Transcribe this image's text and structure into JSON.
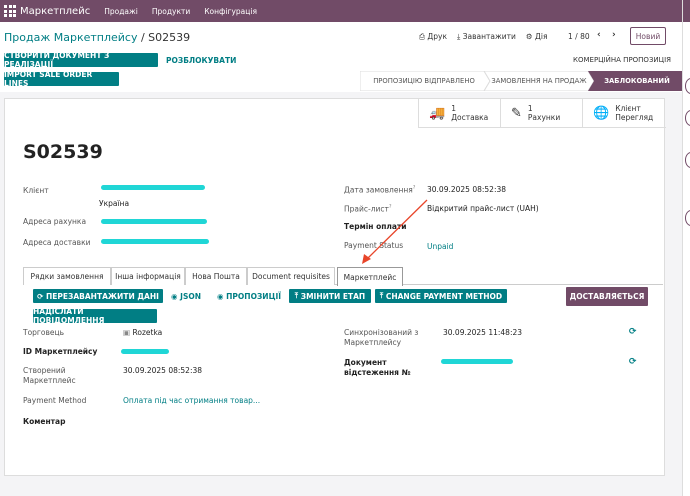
{
  "topbar": {
    "brand": "Маркетплейс",
    "menus": [
      "Продажі",
      "Продукти",
      "Конфігурація"
    ]
  },
  "breadcrumb": {
    "parent": "Продаж Маркетплейсу",
    "separator": " / ",
    "current": "S02539"
  },
  "actions": {
    "print": "Друк",
    "download": "Завантажити",
    "action": "Дія"
  },
  "pager": {
    "value": "1 / 80"
  },
  "new_button": "Новий",
  "header_buttons": {
    "create_doc": "СТВОРИТИ ДОКУМЕНТ З РЕАЛІЗАЦІЇ",
    "unlock": "РОЗБЛОКУВАТИ",
    "import_lines": "IMPORT SALE ORDER LINES",
    "commercial_offer": "КОМЕРЦІЙНА ПРОПОЗИЦІЯ"
  },
  "stages": [
    "ПРОПОЗИЦІЮ ВІДПРАВЛЕНО",
    "ЗАМОВЛЕННЯ НА ПРОДАЖ",
    "ЗАБЛОКОВАНИЙ"
  ],
  "stat_buttons": [
    {
      "icon": "truck-icon",
      "count": "1",
      "label": "Доставка"
    },
    {
      "icon": "edit-icon",
      "count": "1",
      "label": "Рахунки"
    },
    {
      "icon": "globe-icon",
      "count": "Клієнт",
      "label": "Перегляд"
    }
  ],
  "record": {
    "name": "S02539"
  },
  "left_fields": {
    "customer_label": "Клієнт",
    "customer_country": "Україна",
    "invoice_address_label": "Адреса рахунка",
    "delivery_address_label": "Адреса доставки"
  },
  "right_fields": {
    "order_date_label": "Дата замовлення",
    "order_date_value": "30.09.2025 08:52:38",
    "pricelist_label": "Прайс-лист",
    "pricelist_value": "Відкритий прайс-лист (UAH)",
    "payment_terms_label": "Термін оплати",
    "payment_status_label": "Payment Status",
    "payment_status_value": "Unpaid",
    "help_mark": "?"
  },
  "tabs": [
    "Рядки замовлення",
    "Інша інформація",
    "Нова Пошта",
    "Document requisites",
    "Маркетплейс"
  ],
  "marketplace_buttons": {
    "reload": "ПЕРЕЗАВАНТАЖИТИ ДАНІ",
    "json": "JSON",
    "offers": "ПРОПОЗИЦІЇ",
    "change_stage": "ЗМІНИТИ ЕТАП",
    "change_payment": "CHANGE PAYMENT METHOD",
    "send_message": "НАДІСЛАТИ ПОВІДОМЛЕННЯ",
    "delivered": "ДОСТАВЛЯЄТЬСЯ"
  },
  "marketplace_fields": {
    "merchant_label": "Торговець",
    "merchant_value": "Rozetka",
    "marketplace_id_label": "ID Маркетплейсу",
    "created_label": "Створений Маркетплейс",
    "created_value": "30.09.2025 08:52:38",
    "payment_method_label": "Payment Method",
    "payment_method_value": "Оплата під час отримання товар...",
    "comment_label": "Коментар",
    "synced_label": "Синхронізований з Маркетплейсу",
    "synced_value": "30.09.2025 11:48:23",
    "tracking_label": "Документ відстеження №"
  },
  "colors": {
    "brand": "#714b67",
    "accent": "#017e84",
    "redaction": "#20d6d6",
    "annotation_arrow": "#e8452a"
  }
}
